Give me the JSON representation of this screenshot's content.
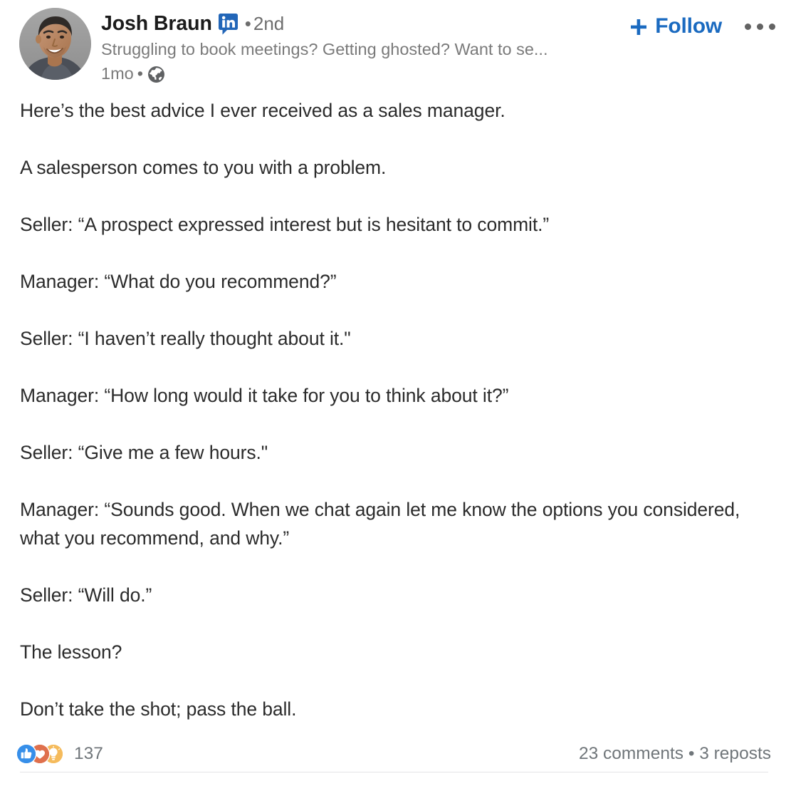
{
  "post": {
    "author": {
      "name": "Josh Braun",
      "badge_icon": "linkedin-logo-icon",
      "separator": "•",
      "degree": "2nd",
      "headline": "Struggling to book meetings? Getting ghosted? Want to se...",
      "timestamp": "1mo",
      "visibility_icon": "globe-icon",
      "avatar_icon": "avatar-photo"
    },
    "actions": {
      "follow_label": "Follow",
      "follow_icon": "plus-icon",
      "follow_color": "#1a6ac0",
      "more_icon": "ellipsis-icon"
    },
    "content": {
      "lines": [
        "Here’s the best advice I ever received as a sales manager.",
        "",
        "A salesperson comes to you with a problem.",
        "",
        "Seller: “A prospect expressed interest but is hesitant to commit.”",
        "",
        "Manager: “What do you recommend?”",
        "",
        "Seller: “I haven’t really thought about it.\"",
        "",
        "Manager: “How long would it take for you to think about it?”",
        "",
        "Seller: “Give me a few hours.\"",
        "",
        "Manager: “Sounds good. When we chat again let me know the options you considered, what you recommend, and why.”",
        "",
        "Seller: “Will do.”",
        "",
        "The lesson?",
        "",
        "Don’t take the shot; pass the ball."
      ]
    },
    "social": {
      "reaction_count": "137",
      "reactions": [
        {
          "name": "like-reaction-icon",
          "color": "#378fe9"
        },
        {
          "name": "love-reaction-icon",
          "color": "#df704d"
        },
        {
          "name": "insightful-reaction-icon",
          "color": "#f5bb5c"
        }
      ],
      "engagement": "23 comments • 3 reposts"
    }
  }
}
